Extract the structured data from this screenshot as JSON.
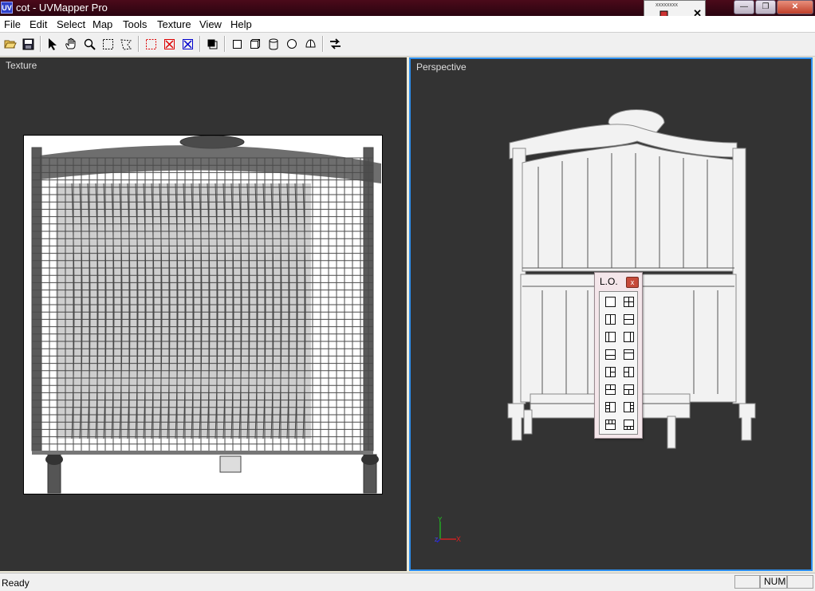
{
  "window": {
    "title": "cot - UVMapper Pro",
    "icon_text": "UV"
  },
  "menu": [
    "File",
    "Edit",
    "Select",
    "Map",
    "Tools",
    "Texture",
    "View",
    "Help"
  ],
  "toolbar": {
    "buttons": [
      "open-folder-icon",
      "save-disk-icon",
      "select-arrow-icon",
      "pan-hand-icon",
      "zoom-icon",
      "marquee-select-icon",
      "lasso-select-icon",
      "select-none-icon",
      "delete-selection-icon",
      "invert-selection-icon",
      "copy-layer-icon",
      "planar-map-icon",
      "box-map-icon",
      "cylindrical-map-icon",
      "spherical-map-icon",
      "polar-map-icon",
      "swap-arrows-icon"
    ]
  },
  "panels": {
    "texture_label": "Texture",
    "perspective_label": "Perspective"
  },
  "lo_window": {
    "title": "L.O.",
    "close": "x"
  },
  "floating_palette": {
    "grip": "xxxxxxxx",
    "close": "✕"
  },
  "status": {
    "text": "Ready",
    "num": "NUM"
  },
  "colors": {
    "accent_border": "#2d8ff0",
    "viewport_bg": "#333333",
    "title_bar": "#3a0614"
  }
}
